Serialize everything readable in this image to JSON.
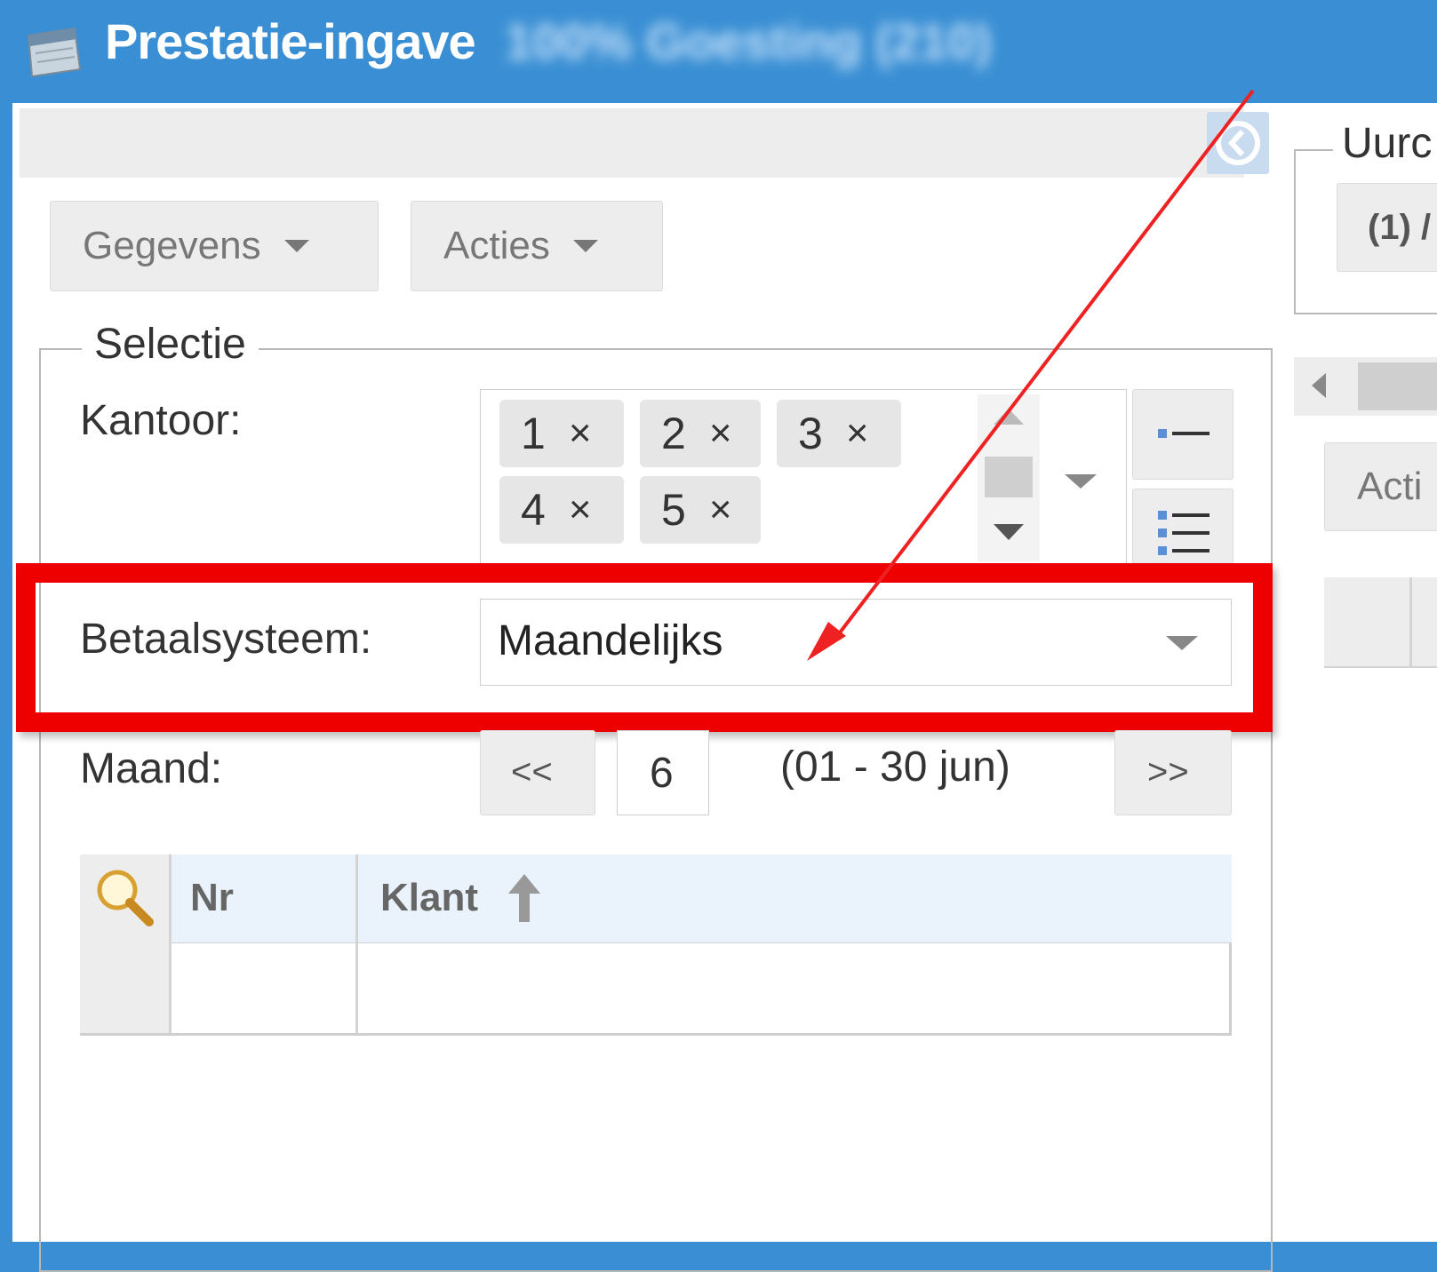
{
  "window": {
    "title": "Prestatie-ingave",
    "title_context_blurred": "100% Goesting (210)"
  },
  "toolbar": {
    "gegevens_label": "Gegevens",
    "acties_label": "Acties"
  },
  "selectie": {
    "legend": "Selectie",
    "kantoor": {
      "label": "Kantoor:",
      "tags": [
        "1",
        "2",
        "3",
        "4",
        "5"
      ]
    },
    "betaalsysteem": {
      "label": "Betaalsysteem:",
      "value": "Maandelijks"
    },
    "maand": {
      "label": "Maand:",
      "prev_label": "<<",
      "value": "6",
      "range": "(01 - 30 jun)",
      "next_label": ">>"
    }
  },
  "grid": {
    "columns": [
      "Nr",
      "Klant"
    ]
  },
  "right_panel": {
    "legend_partial": "Uurc",
    "button_partial": "(1) /",
    "acti_partial": "Acti"
  },
  "icons": {
    "remove": "×",
    "colors": {
      "title_bar": "#3a8fd4",
      "highlight": "#ee0000",
      "grid_header": "#eaf3fb"
    }
  }
}
